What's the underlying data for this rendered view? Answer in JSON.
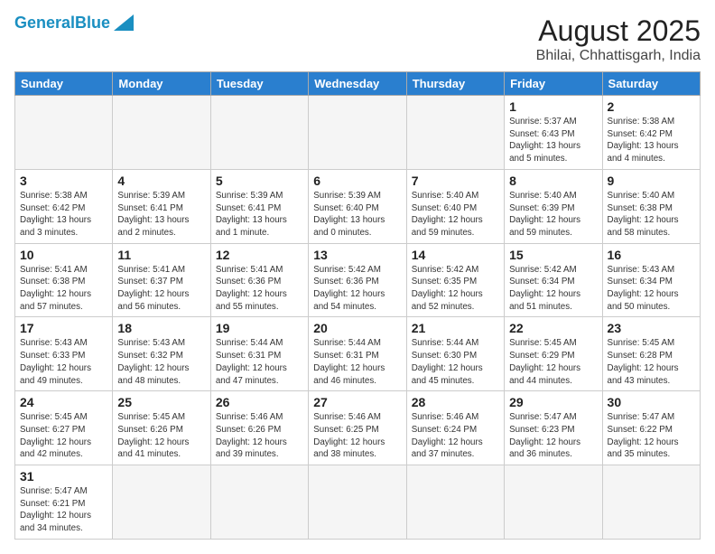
{
  "header": {
    "logo_general": "General",
    "logo_blue": "Blue",
    "title": "August 2025",
    "subtitle": "Bhilai, Chhattisgarh, India"
  },
  "weekdays": [
    "Sunday",
    "Monday",
    "Tuesday",
    "Wednesday",
    "Thursday",
    "Friday",
    "Saturday"
  ],
  "weeks": [
    [
      {
        "day": "",
        "info": ""
      },
      {
        "day": "",
        "info": ""
      },
      {
        "day": "",
        "info": ""
      },
      {
        "day": "",
        "info": ""
      },
      {
        "day": "",
        "info": ""
      },
      {
        "day": "1",
        "info": "Sunrise: 5:37 AM\nSunset: 6:43 PM\nDaylight: 13 hours and 5 minutes."
      },
      {
        "day": "2",
        "info": "Sunrise: 5:38 AM\nSunset: 6:42 PM\nDaylight: 13 hours and 4 minutes."
      }
    ],
    [
      {
        "day": "3",
        "info": "Sunrise: 5:38 AM\nSunset: 6:42 PM\nDaylight: 13 hours and 3 minutes."
      },
      {
        "day": "4",
        "info": "Sunrise: 5:39 AM\nSunset: 6:41 PM\nDaylight: 13 hours and 2 minutes."
      },
      {
        "day": "5",
        "info": "Sunrise: 5:39 AM\nSunset: 6:41 PM\nDaylight: 13 hours and 1 minute."
      },
      {
        "day": "6",
        "info": "Sunrise: 5:39 AM\nSunset: 6:40 PM\nDaylight: 13 hours and 0 minutes."
      },
      {
        "day": "7",
        "info": "Sunrise: 5:40 AM\nSunset: 6:40 PM\nDaylight: 12 hours and 59 minutes."
      },
      {
        "day": "8",
        "info": "Sunrise: 5:40 AM\nSunset: 6:39 PM\nDaylight: 12 hours and 59 minutes."
      },
      {
        "day": "9",
        "info": "Sunrise: 5:40 AM\nSunset: 6:38 PM\nDaylight: 12 hours and 58 minutes."
      }
    ],
    [
      {
        "day": "10",
        "info": "Sunrise: 5:41 AM\nSunset: 6:38 PM\nDaylight: 12 hours and 57 minutes."
      },
      {
        "day": "11",
        "info": "Sunrise: 5:41 AM\nSunset: 6:37 PM\nDaylight: 12 hours and 56 minutes."
      },
      {
        "day": "12",
        "info": "Sunrise: 5:41 AM\nSunset: 6:36 PM\nDaylight: 12 hours and 55 minutes."
      },
      {
        "day": "13",
        "info": "Sunrise: 5:42 AM\nSunset: 6:36 PM\nDaylight: 12 hours and 54 minutes."
      },
      {
        "day": "14",
        "info": "Sunrise: 5:42 AM\nSunset: 6:35 PM\nDaylight: 12 hours and 52 minutes."
      },
      {
        "day": "15",
        "info": "Sunrise: 5:42 AM\nSunset: 6:34 PM\nDaylight: 12 hours and 51 minutes."
      },
      {
        "day": "16",
        "info": "Sunrise: 5:43 AM\nSunset: 6:34 PM\nDaylight: 12 hours and 50 minutes."
      }
    ],
    [
      {
        "day": "17",
        "info": "Sunrise: 5:43 AM\nSunset: 6:33 PM\nDaylight: 12 hours and 49 minutes."
      },
      {
        "day": "18",
        "info": "Sunrise: 5:43 AM\nSunset: 6:32 PM\nDaylight: 12 hours and 48 minutes."
      },
      {
        "day": "19",
        "info": "Sunrise: 5:44 AM\nSunset: 6:31 PM\nDaylight: 12 hours and 47 minutes."
      },
      {
        "day": "20",
        "info": "Sunrise: 5:44 AM\nSunset: 6:31 PM\nDaylight: 12 hours and 46 minutes."
      },
      {
        "day": "21",
        "info": "Sunrise: 5:44 AM\nSunset: 6:30 PM\nDaylight: 12 hours and 45 minutes."
      },
      {
        "day": "22",
        "info": "Sunrise: 5:45 AM\nSunset: 6:29 PM\nDaylight: 12 hours and 44 minutes."
      },
      {
        "day": "23",
        "info": "Sunrise: 5:45 AM\nSunset: 6:28 PM\nDaylight: 12 hours and 43 minutes."
      }
    ],
    [
      {
        "day": "24",
        "info": "Sunrise: 5:45 AM\nSunset: 6:27 PM\nDaylight: 12 hours and 42 minutes."
      },
      {
        "day": "25",
        "info": "Sunrise: 5:45 AM\nSunset: 6:26 PM\nDaylight: 12 hours and 41 minutes."
      },
      {
        "day": "26",
        "info": "Sunrise: 5:46 AM\nSunset: 6:26 PM\nDaylight: 12 hours and 39 minutes."
      },
      {
        "day": "27",
        "info": "Sunrise: 5:46 AM\nSunset: 6:25 PM\nDaylight: 12 hours and 38 minutes."
      },
      {
        "day": "28",
        "info": "Sunrise: 5:46 AM\nSunset: 6:24 PM\nDaylight: 12 hours and 37 minutes."
      },
      {
        "day": "29",
        "info": "Sunrise: 5:47 AM\nSunset: 6:23 PM\nDaylight: 12 hours and 36 minutes."
      },
      {
        "day": "30",
        "info": "Sunrise: 5:47 AM\nSunset: 6:22 PM\nDaylight: 12 hours and 35 minutes."
      }
    ],
    [
      {
        "day": "31",
        "info": "Sunrise: 5:47 AM\nSunset: 6:21 PM\nDaylight: 12 hours and 34 minutes."
      },
      {
        "day": "",
        "info": ""
      },
      {
        "day": "",
        "info": ""
      },
      {
        "day": "",
        "info": ""
      },
      {
        "day": "",
        "info": ""
      },
      {
        "day": "",
        "info": ""
      },
      {
        "day": "",
        "info": ""
      }
    ]
  ]
}
